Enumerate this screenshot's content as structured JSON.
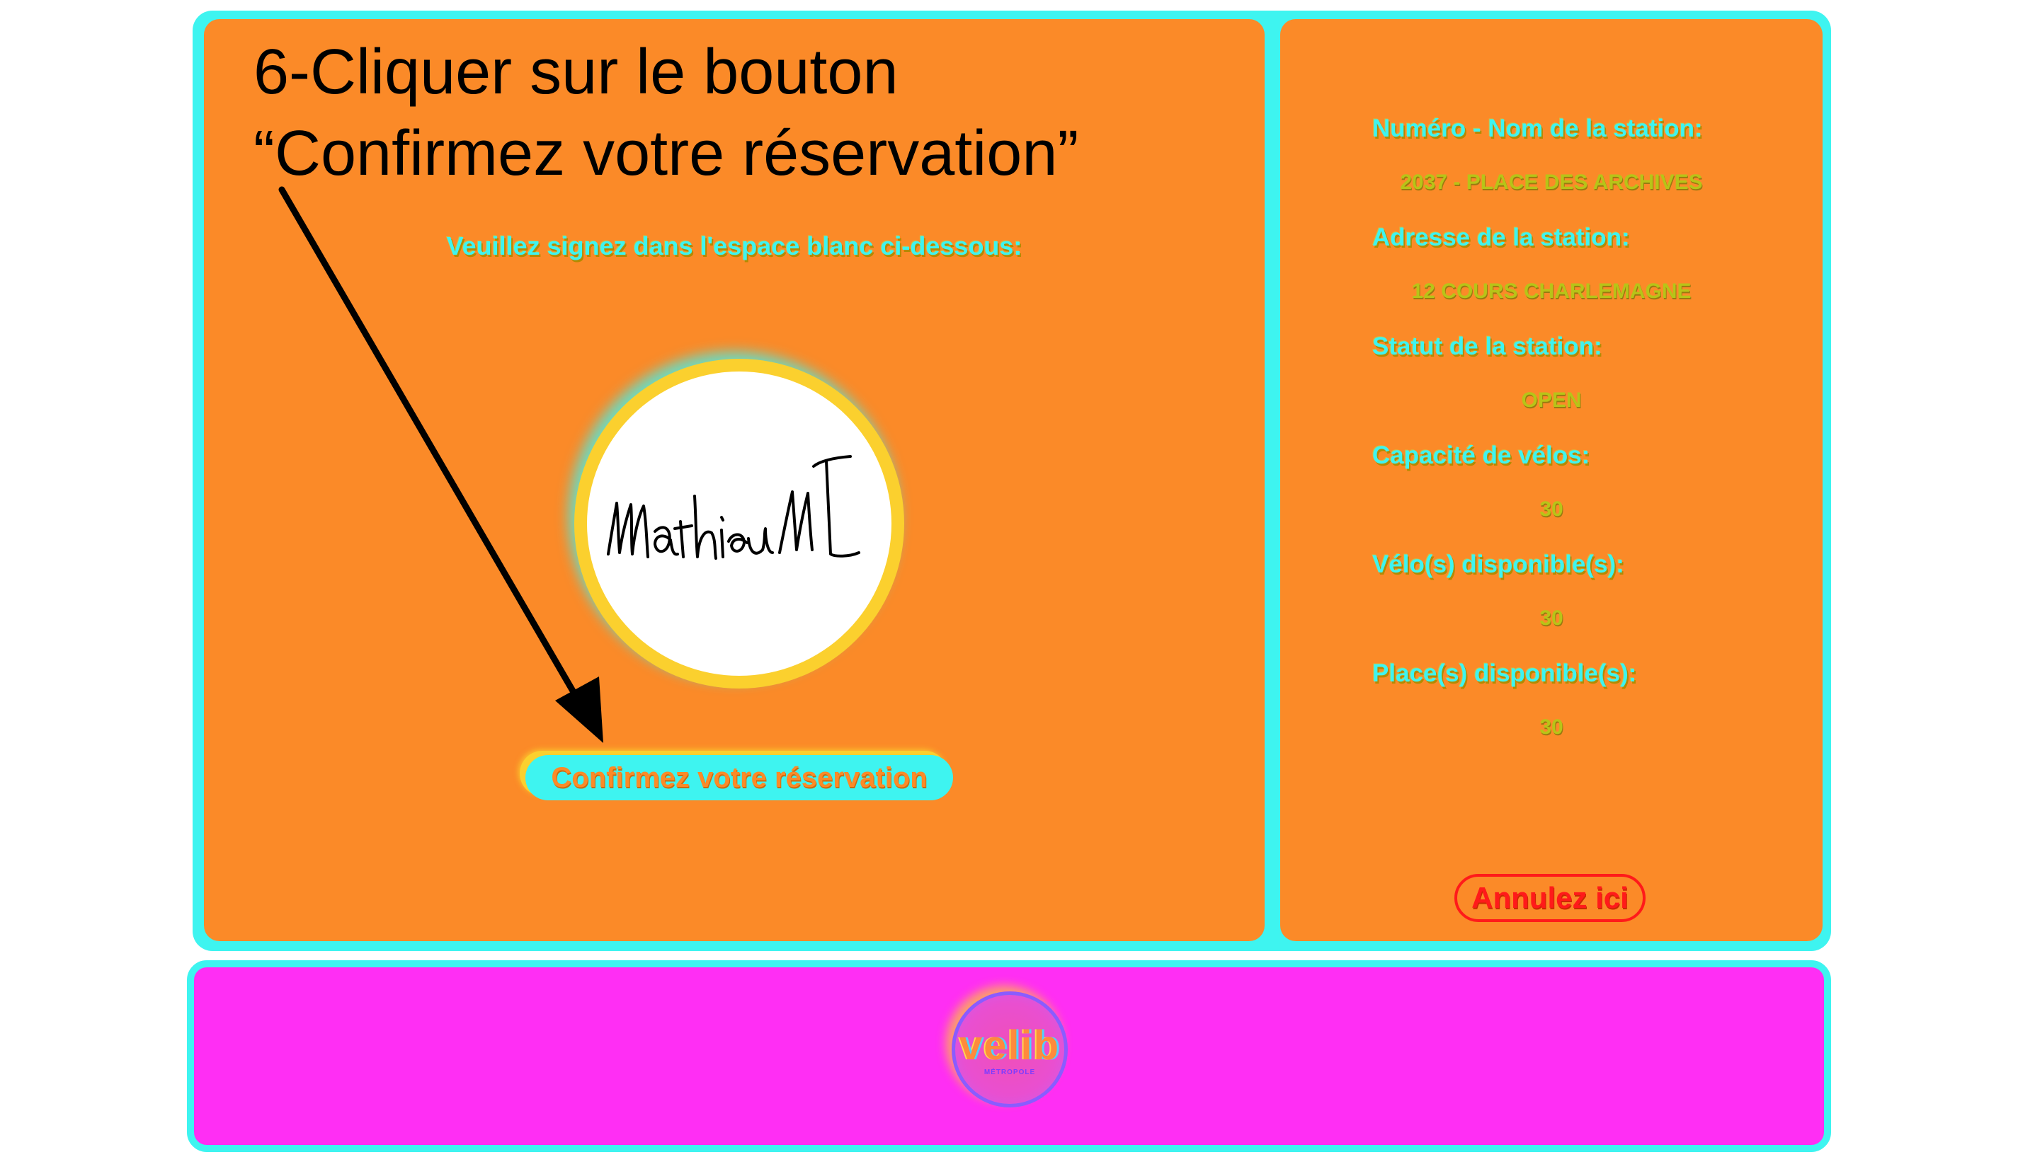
{
  "instruction": {
    "line1": "6-Cliquer sur le bouton",
    "line2": "“Confirmez votre réservation”"
  },
  "signature": {
    "prompt": "Veuillez signez dans l'espace blanc ci-dessous:"
  },
  "confirm_button": {
    "label": "Confirmez votre réservation"
  },
  "station": {
    "number_name_label": "Numéro - Nom de la station:",
    "number_name_value": "2037 - PLACE DES ARCHIVES",
    "address_label": "Adresse de la station:",
    "address_value": "12 COURS CHARLEMAGNE",
    "status_label": "Statut de la station:",
    "status_value": "OPEN",
    "capacity_label": "Capacité de vélos:",
    "capacity_value": "30",
    "bikes_available_label": "Vélo(s) disponible(s):",
    "bikes_available_value": "30",
    "places_available_label": "Place(s) disponible(s):",
    "places_available_value": "30"
  },
  "cancel_button": {
    "label": "Annulez ici"
  },
  "logo": {
    "text": "velib",
    "subtext": "MÉTROPOLE"
  },
  "colors": {
    "frame": "#3ef4f0",
    "panel": "#fb8a28",
    "footer": "#ff2ef4",
    "signature_ring": "#fbd02e",
    "cancel": "#ff1a1a",
    "value_text": "#b7c418"
  }
}
